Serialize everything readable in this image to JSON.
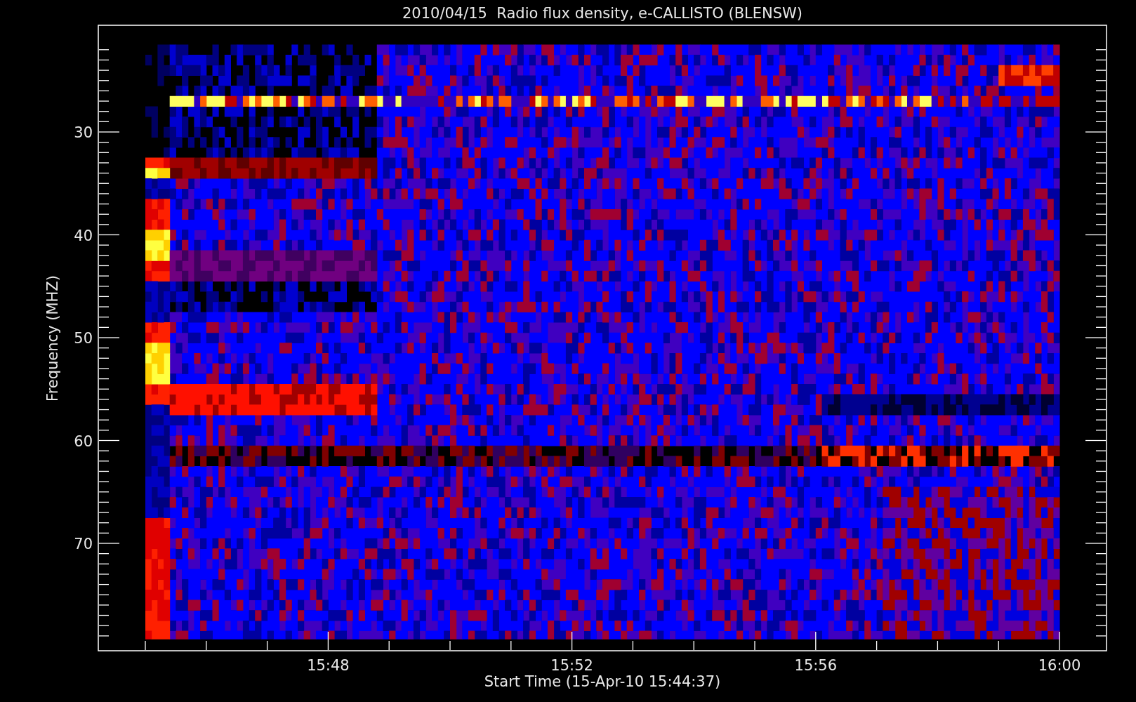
{
  "chart": {
    "title": "2010/04/15  Radio flux density, e-CALLISTO (BLENSW)",
    "ylabel": "Frequency (MHZ)",
    "xlabel": "Start Time (15-Apr-10 15:44:37)",
    "yticks": [
      "30",
      "40",
      "50",
      "60",
      "70"
    ],
    "xticks": [
      "15:48",
      "15:52",
      "15:56",
      "16:00"
    ]
  }
}
